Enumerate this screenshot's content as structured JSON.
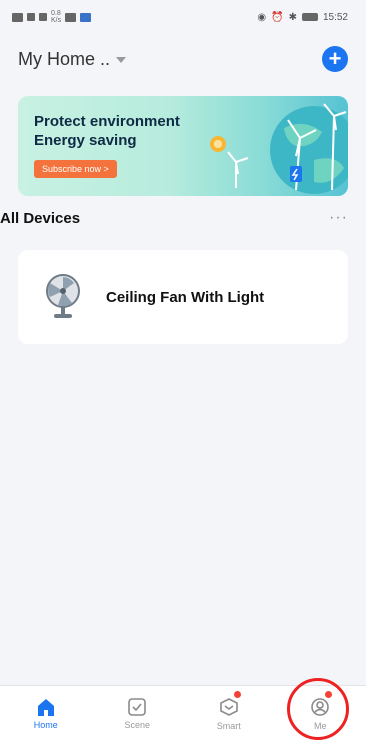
{
  "status_bar": {
    "time": "15:52",
    "net_speed": "0.8\nK/s"
  },
  "header": {
    "home_name": "My Home ..",
    "add_icon": "plus-circle-icon"
  },
  "banner": {
    "title_line1": "Protect environment",
    "title_line2": "Energy saving",
    "cta": "Subscribe now >"
  },
  "section": {
    "title": "All Devices",
    "more": "···"
  },
  "devices": [
    {
      "name": "Ceiling Fan With Light",
      "icon": "fan-icon"
    }
  ],
  "tabbar": [
    {
      "label": "Home",
      "icon": "home-icon",
      "active": true
    },
    {
      "label": "Scene",
      "icon": "scene-icon",
      "active": false
    },
    {
      "label": "Smart",
      "icon": "smart-icon",
      "active": false
    },
    {
      "label": "Me",
      "icon": "me-icon",
      "active": false
    }
  ],
  "colors": {
    "accent": "#1b74f0",
    "cta": "#f4733c",
    "alert": "#f44336"
  }
}
